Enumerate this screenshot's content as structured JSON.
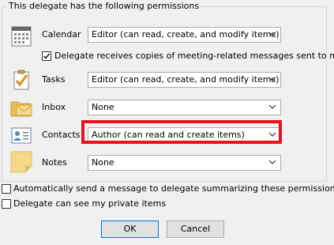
{
  "group": {
    "title": "This delegate has the following permissions"
  },
  "permissions": [
    {
      "id": "calendar",
      "label": "Calendar",
      "value": "Editor (can read, create, and modify items)",
      "icon": "calendar-icon"
    },
    {
      "id": "tasks",
      "label": "Tasks",
      "value": "Editor (can read, create, and modify items)",
      "icon": "tasks-icon"
    },
    {
      "id": "inbox",
      "label": "Inbox",
      "value": "None",
      "icon": "inbox-icon"
    },
    {
      "id": "contacts",
      "label": "Contacts",
      "value": "Author (can read and create items)",
      "icon": "contacts-icon"
    },
    {
      "id": "notes",
      "label": "Notes",
      "value": "None",
      "icon": "notes-icon"
    }
  ],
  "calendar_copy": {
    "label": "Delegate receives copies of meeting-related messages sent to me",
    "checked": true
  },
  "options": [
    {
      "label": "Automatically send a message to delegate summarizing these permissions",
      "checked": false
    },
    {
      "label": "Delegate can see my private items",
      "checked": false
    }
  ],
  "buttons": {
    "ok": "OK",
    "cancel": "Cancel"
  },
  "colors": {
    "highlight": "#e8111c",
    "ok_border": "#0078d7"
  }
}
